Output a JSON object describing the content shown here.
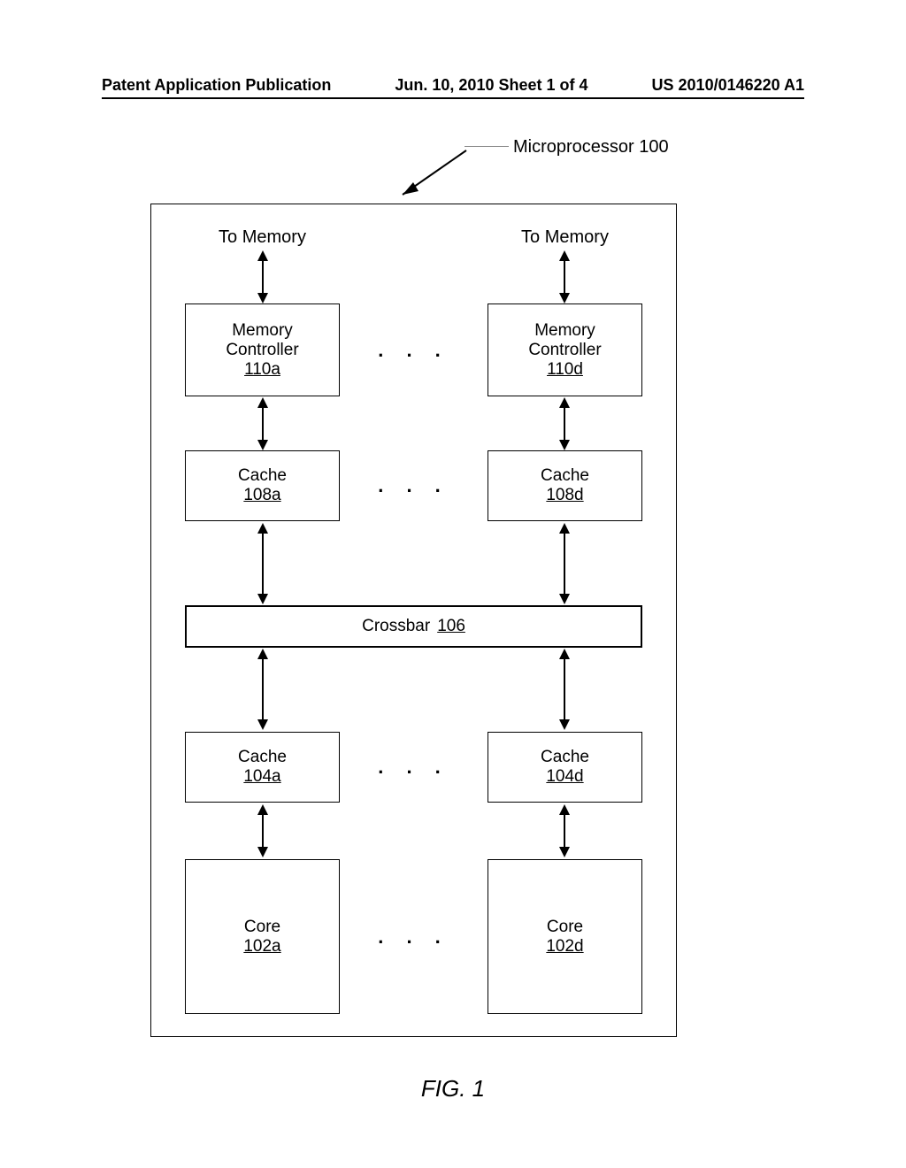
{
  "header": {
    "left": "Patent Application Publication",
    "center": "Jun. 10, 2010  Sheet 1 of 4",
    "right": "US 2010/0146220 A1"
  },
  "callout": "Microprocessor 100",
  "toMemory": "To Memory",
  "memController": {
    "label": "Memory Controller",
    "left_ref": "110a",
    "right_ref": "110d"
  },
  "cacheTop": {
    "label": "Cache",
    "left_ref": "108a",
    "right_ref": "108d"
  },
  "crossbar": {
    "label": "Crossbar",
    "ref": "106"
  },
  "cacheBottom": {
    "label": "Cache",
    "left_ref": "104a",
    "right_ref": "104d"
  },
  "core": {
    "label": "Core",
    "left_ref": "102a",
    "right_ref": "102d"
  },
  "ellipsis": ". . .",
  "figLabel": "FIG. 1"
}
